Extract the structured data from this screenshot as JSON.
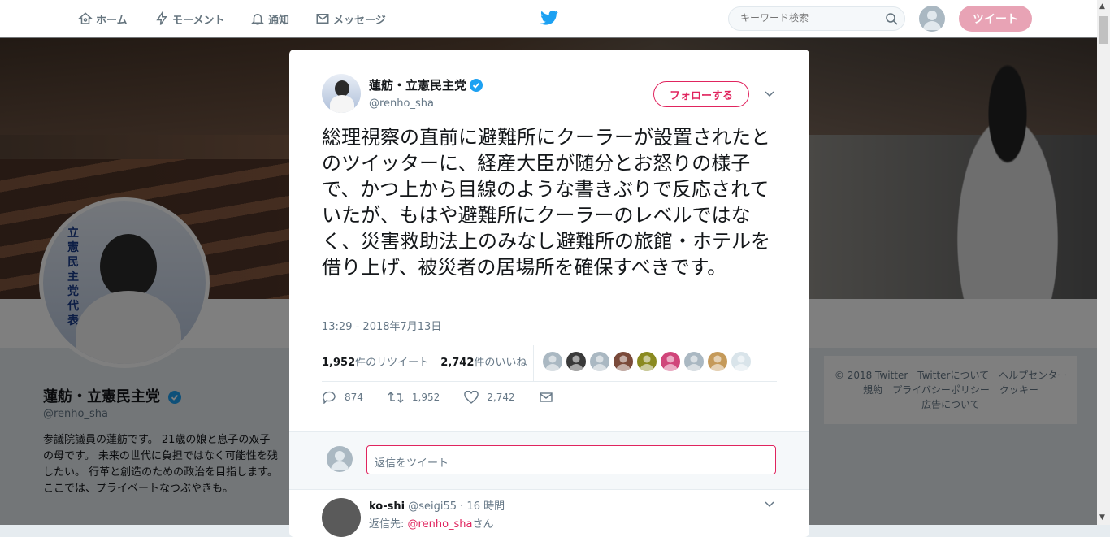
{
  "nav": {
    "home": "ホーム",
    "moments": "モーメント",
    "notifications": "通知",
    "messages": "メッセージ",
    "search_placeholder": "キーワード検索",
    "tweet_button": "ツイート"
  },
  "profile": {
    "name": "蓮舫・立憲民主党",
    "handle": "@renho_sha",
    "bio": "参議院議員の蓮舫です。 21歳の娘と息子の双子の母です。 未来の世代に負担ではなく可能性を残したい。 行革と創造のための政治を目指します。 ここでは、プライベートなつぶやきも。",
    "avatar_text": "立憲民主党代表"
  },
  "footer": {
    "line1": "© 2018 Twitter　Twitterについて　ヘルプセンター",
    "line2": "規約　プライバシーポリシー　クッキー",
    "line3": "広告について"
  },
  "tweet": {
    "author_name": "蓮舫・立憲民主党",
    "author_handle": "@renho_sha",
    "follow_label": "フォローする",
    "text": "総理視察の直前に避難所にクーラーが設置されたとのツイッターに、経産大臣が随分とお怒りの様子で、かつ上から目線のような書きぶりで反応されていたが、もはや避難所にクーラーのレベルではなく、災害救助法上のみなし避難所の旅館・ホテルを借り上げ、被災者の居場所を確保すべきです。",
    "timestamp": "13:29 - 2018年7月13日",
    "retweet_count": "1,952",
    "retweet_label": "件のリツイート",
    "like_count": "2,742",
    "like_label": "件のいいね",
    "reply_action_count": "874",
    "retweet_action_count": "1,952",
    "like_action_count": "2,742"
  },
  "likers": [
    "#aab8c2",
    "#3a3a3a",
    "#aab8c2",
    "#7a4a3a",
    "#8a8a20",
    "#d0457a",
    "#aab8c2",
    "#c59a5a",
    "#d9e4ea"
  ],
  "reply_box": {
    "placeholder": "返信をツイート"
  },
  "first_reply": {
    "name": "ko-shi",
    "handle": "@seigi55",
    "time": "· 16 時間",
    "reply_to_prefix": "返信先:",
    "reply_to_handle": "@renho_sha",
    "reply_to_suffix": "さん"
  },
  "colors": {
    "accent": "#e0245e",
    "brand_blue": "#1da1f2",
    "text_secondary": "#657786"
  }
}
